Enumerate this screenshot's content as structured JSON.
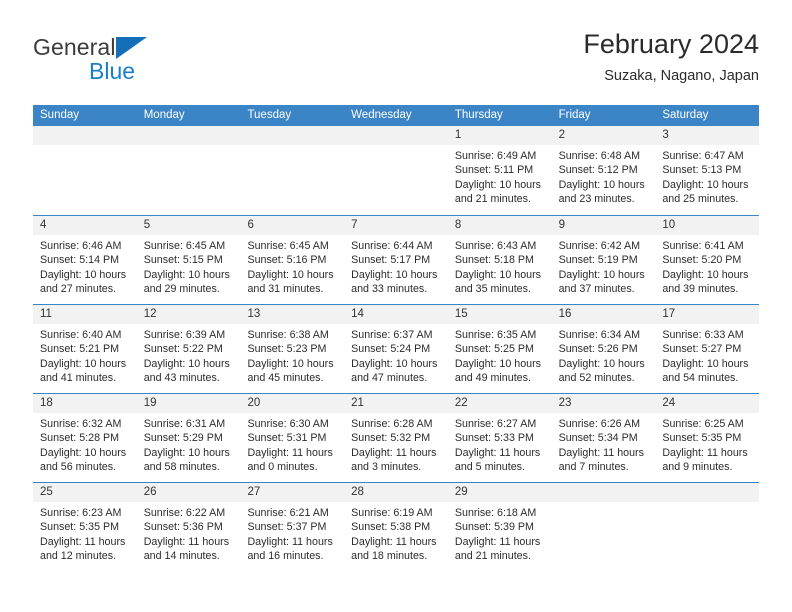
{
  "brand": {
    "name_top": "General",
    "name_bottom": "Blue",
    "accent_color": "#1a7ec8",
    "triangle_color": "#136fb8"
  },
  "header": {
    "title": "February 2024",
    "subtitle": "Suzaka, Nagano, Japan"
  },
  "theme": {
    "header_row_bg": "#3b85c6",
    "day_head_bg": "#f2f2f2",
    "grid_line": "#3b85c6",
    "text": "#2c2c2c"
  },
  "weekdays": [
    "Sunday",
    "Monday",
    "Tuesday",
    "Wednesday",
    "Thursday",
    "Friday",
    "Saturday"
  ],
  "weeks": [
    [
      {
        "day": "",
        "lines": []
      },
      {
        "day": "",
        "lines": []
      },
      {
        "day": "",
        "lines": []
      },
      {
        "day": "",
        "lines": []
      },
      {
        "day": "1",
        "lines": [
          "Sunrise: 6:49 AM",
          "Sunset: 5:11 PM",
          "Daylight: 10 hours",
          "and 21 minutes."
        ]
      },
      {
        "day": "2",
        "lines": [
          "Sunrise: 6:48 AM",
          "Sunset: 5:12 PM",
          "Daylight: 10 hours",
          "and 23 minutes."
        ]
      },
      {
        "day": "3",
        "lines": [
          "Sunrise: 6:47 AM",
          "Sunset: 5:13 PM",
          "Daylight: 10 hours",
          "and 25 minutes."
        ]
      }
    ],
    [
      {
        "day": "4",
        "lines": [
          "Sunrise: 6:46 AM",
          "Sunset: 5:14 PM",
          "Daylight: 10 hours",
          "and 27 minutes."
        ]
      },
      {
        "day": "5",
        "lines": [
          "Sunrise: 6:45 AM",
          "Sunset: 5:15 PM",
          "Daylight: 10 hours",
          "and 29 minutes."
        ]
      },
      {
        "day": "6",
        "lines": [
          "Sunrise: 6:45 AM",
          "Sunset: 5:16 PM",
          "Daylight: 10 hours",
          "and 31 minutes."
        ]
      },
      {
        "day": "7",
        "lines": [
          "Sunrise: 6:44 AM",
          "Sunset: 5:17 PM",
          "Daylight: 10 hours",
          "and 33 minutes."
        ]
      },
      {
        "day": "8",
        "lines": [
          "Sunrise: 6:43 AM",
          "Sunset: 5:18 PM",
          "Daylight: 10 hours",
          "and 35 minutes."
        ]
      },
      {
        "day": "9",
        "lines": [
          "Sunrise: 6:42 AM",
          "Sunset: 5:19 PM",
          "Daylight: 10 hours",
          "and 37 minutes."
        ]
      },
      {
        "day": "10",
        "lines": [
          "Sunrise: 6:41 AM",
          "Sunset: 5:20 PM",
          "Daylight: 10 hours",
          "and 39 minutes."
        ]
      }
    ],
    [
      {
        "day": "11",
        "lines": [
          "Sunrise: 6:40 AM",
          "Sunset: 5:21 PM",
          "Daylight: 10 hours",
          "and 41 minutes."
        ]
      },
      {
        "day": "12",
        "lines": [
          "Sunrise: 6:39 AM",
          "Sunset: 5:22 PM",
          "Daylight: 10 hours",
          "and 43 minutes."
        ]
      },
      {
        "day": "13",
        "lines": [
          "Sunrise: 6:38 AM",
          "Sunset: 5:23 PM",
          "Daylight: 10 hours",
          "and 45 minutes."
        ]
      },
      {
        "day": "14",
        "lines": [
          "Sunrise: 6:37 AM",
          "Sunset: 5:24 PM",
          "Daylight: 10 hours",
          "and 47 minutes."
        ]
      },
      {
        "day": "15",
        "lines": [
          "Sunrise: 6:35 AM",
          "Sunset: 5:25 PM",
          "Daylight: 10 hours",
          "and 49 minutes."
        ]
      },
      {
        "day": "16",
        "lines": [
          "Sunrise: 6:34 AM",
          "Sunset: 5:26 PM",
          "Daylight: 10 hours",
          "and 52 minutes."
        ]
      },
      {
        "day": "17",
        "lines": [
          "Sunrise: 6:33 AM",
          "Sunset: 5:27 PM",
          "Daylight: 10 hours",
          "and 54 minutes."
        ]
      }
    ],
    [
      {
        "day": "18",
        "lines": [
          "Sunrise: 6:32 AM",
          "Sunset: 5:28 PM",
          "Daylight: 10 hours",
          "and 56 minutes."
        ]
      },
      {
        "day": "19",
        "lines": [
          "Sunrise: 6:31 AM",
          "Sunset: 5:29 PM",
          "Daylight: 10 hours",
          "and 58 minutes."
        ]
      },
      {
        "day": "20",
        "lines": [
          "Sunrise: 6:30 AM",
          "Sunset: 5:31 PM",
          "Daylight: 11 hours",
          "and 0 minutes."
        ]
      },
      {
        "day": "21",
        "lines": [
          "Sunrise: 6:28 AM",
          "Sunset: 5:32 PM",
          "Daylight: 11 hours",
          "and 3 minutes."
        ]
      },
      {
        "day": "22",
        "lines": [
          "Sunrise: 6:27 AM",
          "Sunset: 5:33 PM",
          "Daylight: 11 hours",
          "and 5 minutes."
        ]
      },
      {
        "day": "23",
        "lines": [
          "Sunrise: 6:26 AM",
          "Sunset: 5:34 PM",
          "Daylight: 11 hours",
          "and 7 minutes."
        ]
      },
      {
        "day": "24",
        "lines": [
          "Sunrise: 6:25 AM",
          "Sunset: 5:35 PM",
          "Daylight: 11 hours",
          "and 9 minutes."
        ]
      }
    ],
    [
      {
        "day": "25",
        "lines": [
          "Sunrise: 6:23 AM",
          "Sunset: 5:35 PM",
          "Daylight: 11 hours",
          "and 12 minutes."
        ]
      },
      {
        "day": "26",
        "lines": [
          "Sunrise: 6:22 AM",
          "Sunset: 5:36 PM",
          "Daylight: 11 hours",
          "and 14 minutes."
        ]
      },
      {
        "day": "27",
        "lines": [
          "Sunrise: 6:21 AM",
          "Sunset: 5:37 PM",
          "Daylight: 11 hours",
          "and 16 minutes."
        ]
      },
      {
        "day": "28",
        "lines": [
          "Sunrise: 6:19 AM",
          "Sunset: 5:38 PM",
          "Daylight: 11 hours",
          "and 18 minutes."
        ]
      },
      {
        "day": "29",
        "lines": [
          "Sunrise: 6:18 AM",
          "Sunset: 5:39 PM",
          "Daylight: 11 hours",
          "and 21 minutes."
        ]
      },
      {
        "day": "",
        "lines": []
      },
      {
        "day": "",
        "lines": []
      }
    ]
  ]
}
